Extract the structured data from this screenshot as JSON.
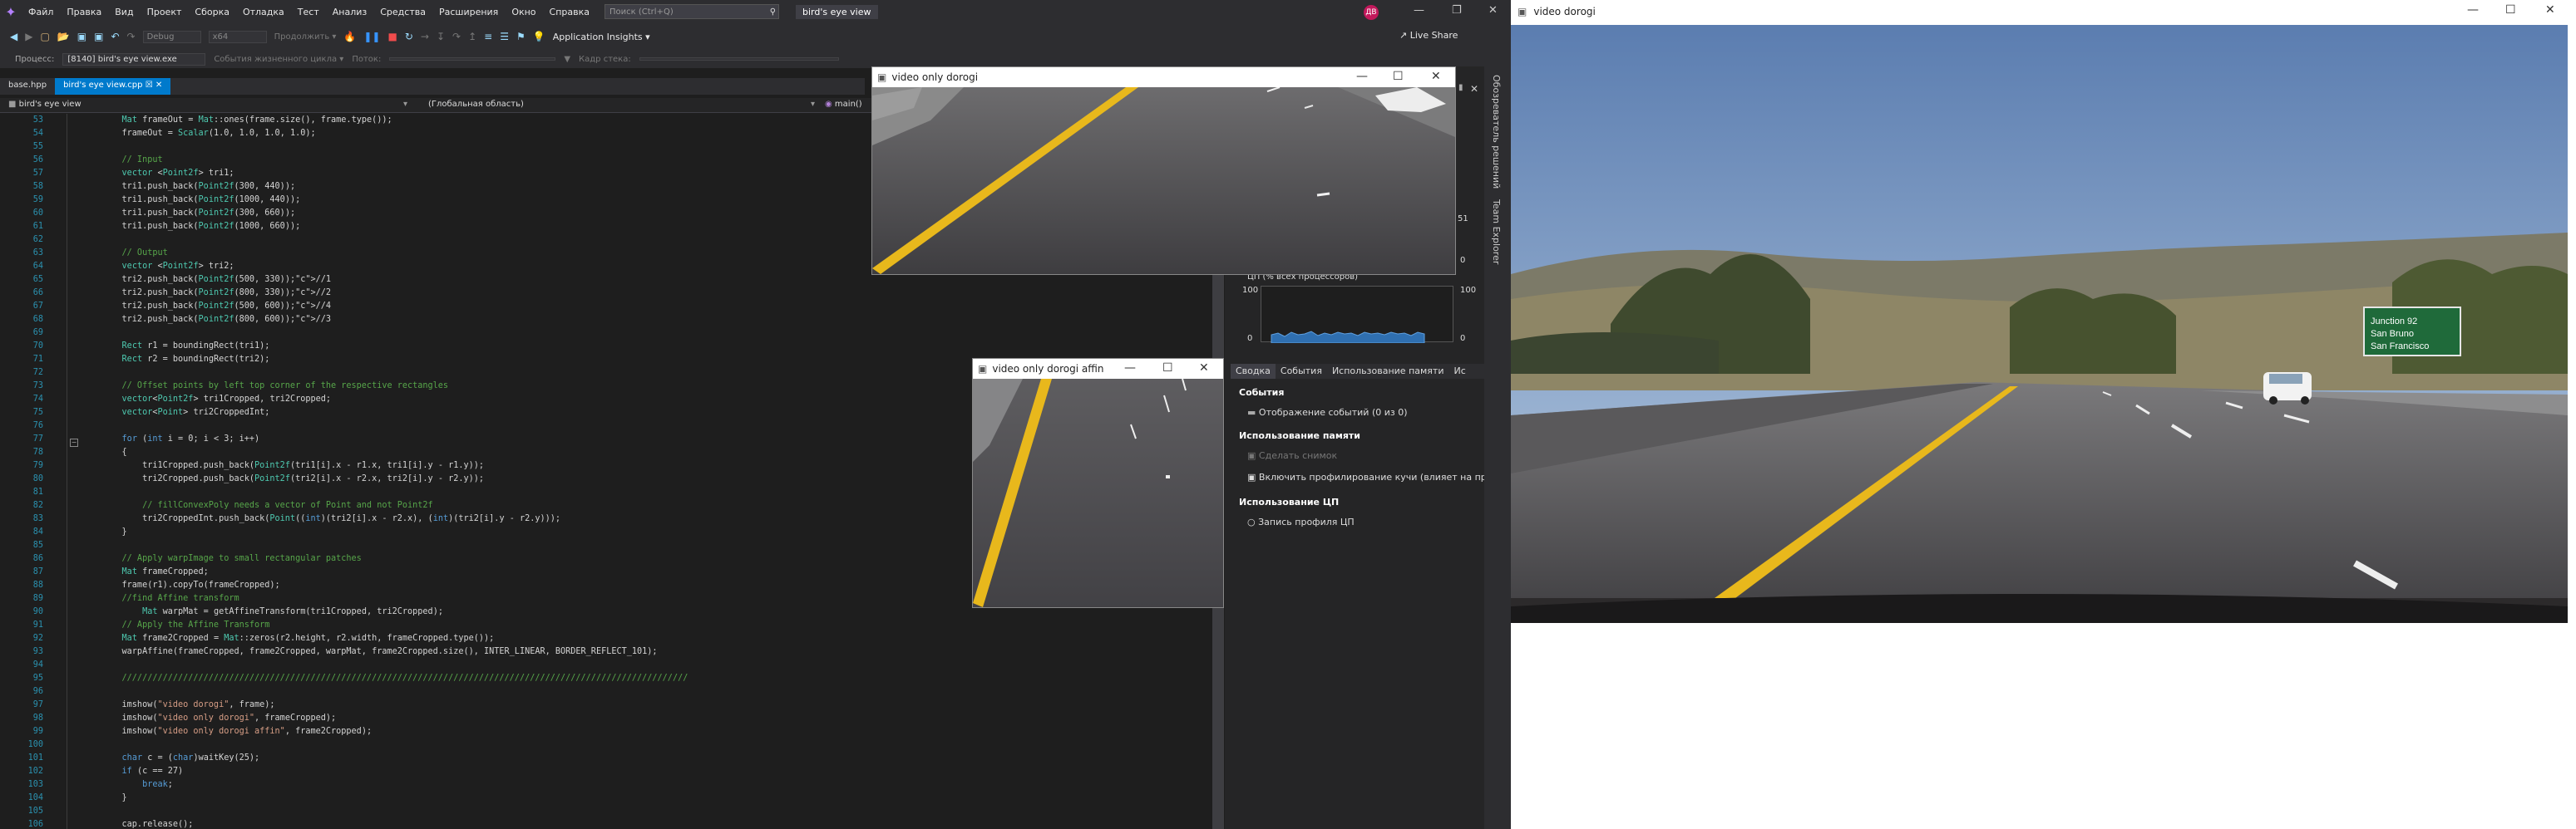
{
  "vs": {
    "menu": [
      "Файл",
      "Правка",
      "Вид",
      "Проект",
      "Сборка",
      "Отладка",
      "Тест",
      "Анализ",
      "Средства",
      "Расширения",
      "Окно",
      "Справка"
    ],
    "search_placeholder": "Поиск (Ctrl+Q)",
    "solution_title": "bird's eye view",
    "avatar": "ДВ",
    "toolbar": {
      "config": "Debug",
      "platform": "x64",
      "continue": "Продолжить ▾",
      "app_insights": "Application Insights ▾",
      "live_share": "Live Share"
    },
    "toolbar2": {
      "process_label": "Процесс:",
      "process_value": "[8140] bird's eye view.exe",
      "lifecycle": "События жизненного цикла ▾",
      "thread_label": "Поток:",
      "frame_label": "Кадр стека:"
    },
    "tabs": [
      "base.hpp",
      "bird's eye view.cpp"
    ],
    "nav": {
      "project": "bird's eye view",
      "scope": "(Глобальная область)",
      "func": "main()"
    },
    "code_lines": [
      {
        "n": "53",
        "t": "    Mat frameOut = Mat::ones(frame.size(), frame.type());"
      },
      {
        "n": "54",
        "t": "    frameOut = Scalar(1.0, 1.0, 1.0, 1.0);"
      },
      {
        "n": "55",
        "t": ""
      },
      {
        "n": "56",
        "t": "    // Input"
      },
      {
        "n": "57",
        "t": "    vector <Point2f> tri1;"
      },
      {
        "n": "58",
        "t": "    tri1.push_back(Point2f(300, 440));"
      },
      {
        "n": "59",
        "t": "    tri1.push_back(Point2f(1000, 440));"
      },
      {
        "n": "60",
        "t": "    tri1.push_back(Point2f(300, 660));"
      },
      {
        "n": "61",
        "t": "    tri1.push_back(Point2f(1000, 660));"
      },
      {
        "n": "62",
        "t": ""
      },
      {
        "n": "63",
        "t": "    // Output"
      },
      {
        "n": "64",
        "t": "    vector <Point2f> tri2;"
      },
      {
        "n": "65",
        "t": "    tri2.push_back(Point2f(500, 330));//1"
      },
      {
        "n": "66",
        "t": "    tri2.push_back(Point2f(800, 330));//2"
      },
      {
        "n": "67",
        "t": "    tri2.push_back(Point2f(500, 600));//4"
      },
      {
        "n": "68",
        "t": "    tri2.push_back(Point2f(800, 600));//3"
      },
      {
        "n": "69",
        "t": ""
      },
      {
        "n": "70",
        "t": "    Rect r1 = boundingRect(tri1);"
      },
      {
        "n": "71",
        "t": "    Rect r2 = boundingRect(tri2);"
      },
      {
        "n": "72",
        "t": ""
      },
      {
        "n": "73",
        "t": "    // Offset points by left top corner of the respective rectangles"
      },
      {
        "n": "74",
        "t": "    vector<Point2f> tri1Cropped, tri2Cropped;"
      },
      {
        "n": "75",
        "t": "    vector<Point> tri2CroppedInt;"
      },
      {
        "n": "76",
        "t": ""
      },
      {
        "n": "77",
        "t": "    for (int i = 0; i < 3; i++)"
      },
      {
        "n": "78",
        "t": "    {"
      },
      {
        "n": "79",
        "t": "        tri1Cropped.push_back(Point2f(tri1[i].x - r1.x, tri1[i].y - r1.y));"
      },
      {
        "n": "80",
        "t": "        tri2Cropped.push_back(Point2f(tri2[i].x - r2.x, tri2[i].y - r2.y));"
      },
      {
        "n": "81",
        "t": ""
      },
      {
        "n": "82",
        "t": "        // fillConvexPoly needs a vector of Point and not Point2f"
      },
      {
        "n": "83",
        "t": "        tri2CroppedInt.push_back(Point((int)(tri2[i].x - r2.x), (int)(tri2[i].y - r2.y)));"
      },
      {
        "n": "84",
        "t": "    }"
      },
      {
        "n": "85",
        "t": ""
      },
      {
        "n": "86",
        "t": "    // Apply warpImage to small rectangular patches"
      },
      {
        "n": "87",
        "t": "    Mat frameCropped;"
      },
      {
        "n": "88",
        "t": "    frame(r1).copyTo(frameCropped);"
      },
      {
        "n": "89",
        "t": "    //find Affine transform"
      },
      {
        "n": "90",
        "t": "        Mat warpMat = getAffineTransform(tri1Cropped, tri2Cropped);"
      },
      {
        "n": "91",
        "t": "    // Apply the Affine Transform"
      },
      {
        "n": "92",
        "t": "    Mat frame2Cropped = Mat::zeros(r2.height, r2.width, frameCropped.type());"
      },
      {
        "n": "93",
        "t": "    warpAffine(frameCropped, frame2Cropped, warpMat, frame2Cropped.size(), INTER_LINEAR, BORDER_REFLECT_101);"
      },
      {
        "n": "94",
        "t": ""
      },
      {
        "n": "95",
        "t": "    ///////////////////////////////////////////////////////////////////////////////////////////////////////////////"
      },
      {
        "n": "96",
        "t": ""
      },
      {
        "n": "97",
        "t": "    imshow(\"video dorogi\", frame);"
      },
      {
        "n": "98",
        "t": "    imshow(\"video only dorogi\", frameCropped);"
      },
      {
        "n": "99",
        "t": "    imshow(\"video only dorogi affin\", frame2Cropped);"
      },
      {
        "n": "100",
        "t": ""
      },
      {
        "n": "101",
        "t": "    char c = (char)waitKey(25);"
      },
      {
        "n": "102",
        "t": "    if (c == 27)"
      },
      {
        "n": "103",
        "t": "        break;"
      },
      {
        "n": "104",
        "t": "    }"
      },
      {
        "n": "105",
        "t": ""
      },
      {
        "n": "106",
        "t": "    cap.release();"
      }
    ],
    "diag": {
      "cpu_label": "ЦП (% всех процессоров)",
      "cpu_max": "100",
      "cpu_min": "0",
      "cpu_max_r": "100",
      "cpu_min_r": "0",
      "mem_val": "51",
      "mem_min": "0",
      "tabs": [
        "Сводка",
        "События",
        "Использование памяти",
        "Ис"
      ],
      "events_header": "События",
      "events_item": "Отображение событий (0 из 0)",
      "memory_header": "Использование памяти",
      "snapshot": "Сделать снимок",
      "heap_profiling": "Включить профилирование кучи (влияет на пр",
      "cpu_header": "Использование ЦП",
      "cpu_profile": "Запись профиля ЦП"
    },
    "side_tabs": [
      "Обозреватель решений",
      "Team Explorer"
    ]
  },
  "windows": {
    "only": "video only dorogi",
    "affin": "video only dorogi affin",
    "main": "video dorogi"
  },
  "colors": {
    "vs_bg": "#1e1e1e",
    "accent": "#007acc",
    "lane_yellow": "#e8b81c"
  }
}
